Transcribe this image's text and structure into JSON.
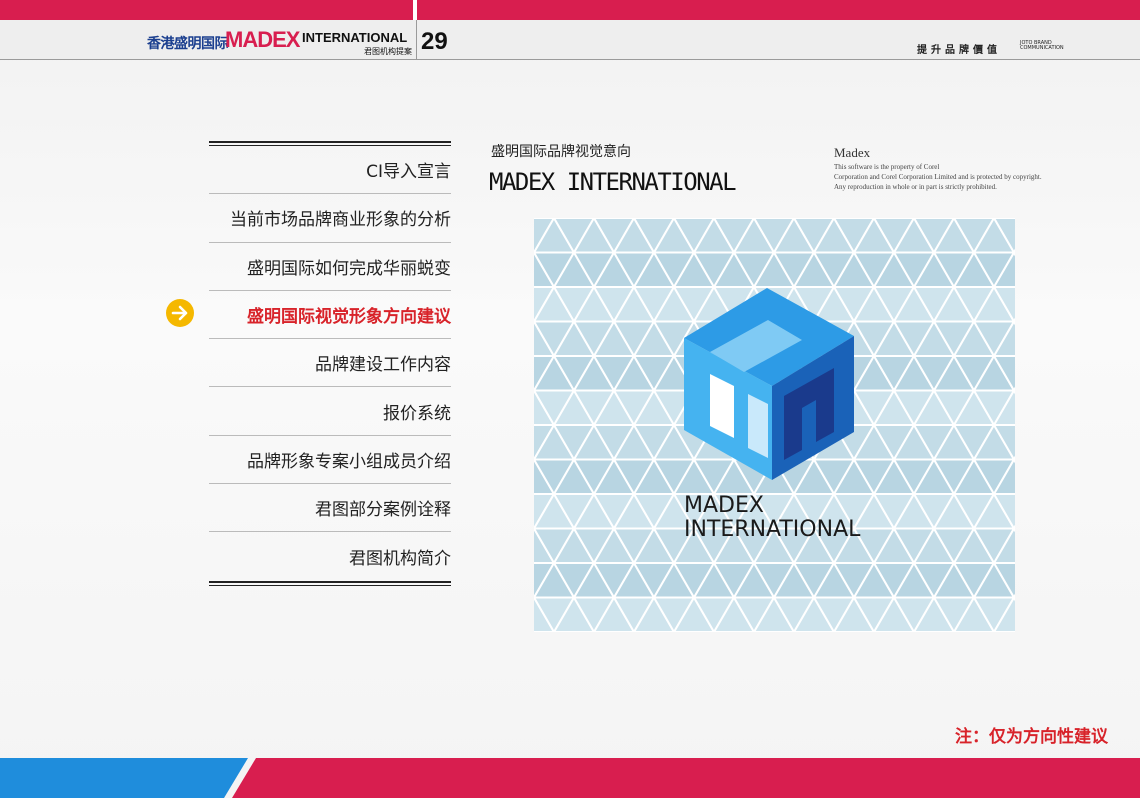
{
  "header": {
    "brand_cn": "香港盛明国际",
    "brand_madex": "MADEX",
    "brand_international": "INTERNATIONAL",
    "brand_sub": "君图机构提案",
    "page_number": "29",
    "slogan": "提升品牌價值",
    "slogan_en": [
      "JOTO BRAND",
      "COMMUNICATION"
    ]
  },
  "menu": {
    "items": [
      {
        "label": "CI导入宣言"
      },
      {
        "label": "当前市场品牌商业形象的分析"
      },
      {
        "label": "盛明国际如何完成华丽蜕变"
      },
      {
        "label": "盛明国际视觉形象方向建议"
      },
      {
        "label": "品牌建设工作内容"
      },
      {
        "label": "报价系统"
      },
      {
        "label": "品牌形象专案小组成员介绍"
      },
      {
        "label": "君图部分案例诠释"
      },
      {
        "label": "君图机构简介"
      }
    ],
    "active_index": 3,
    "active_icon": "arrow-right-circle-icon"
  },
  "section": {
    "title_cn": "盛明国际品牌视觉意向",
    "title_en": "MADEX INTERNATIONAL"
  },
  "corel": {
    "title": "Madex",
    "lines": [
      "This software is the property of Corel",
      "Corporation and Corel Corporation Limited and is protected by copyright.",
      "Any reproduction in whole or in part is strictly prohibited."
    ]
  },
  "logo": {
    "text_line1": "MADEX",
    "text_line2": "INTERNATIONAL",
    "icon": "cube-logo-icon"
  },
  "note": "注：仅为方向性建议",
  "colors": {
    "accent_red": "#d81e4f",
    "accent_blue": "#1f8ddc",
    "active_text": "#d8232a",
    "arrow_yellow": "#f5b800",
    "pattern_light": "#c4dde8",
    "logo_dark": "#1a3a8c"
  }
}
